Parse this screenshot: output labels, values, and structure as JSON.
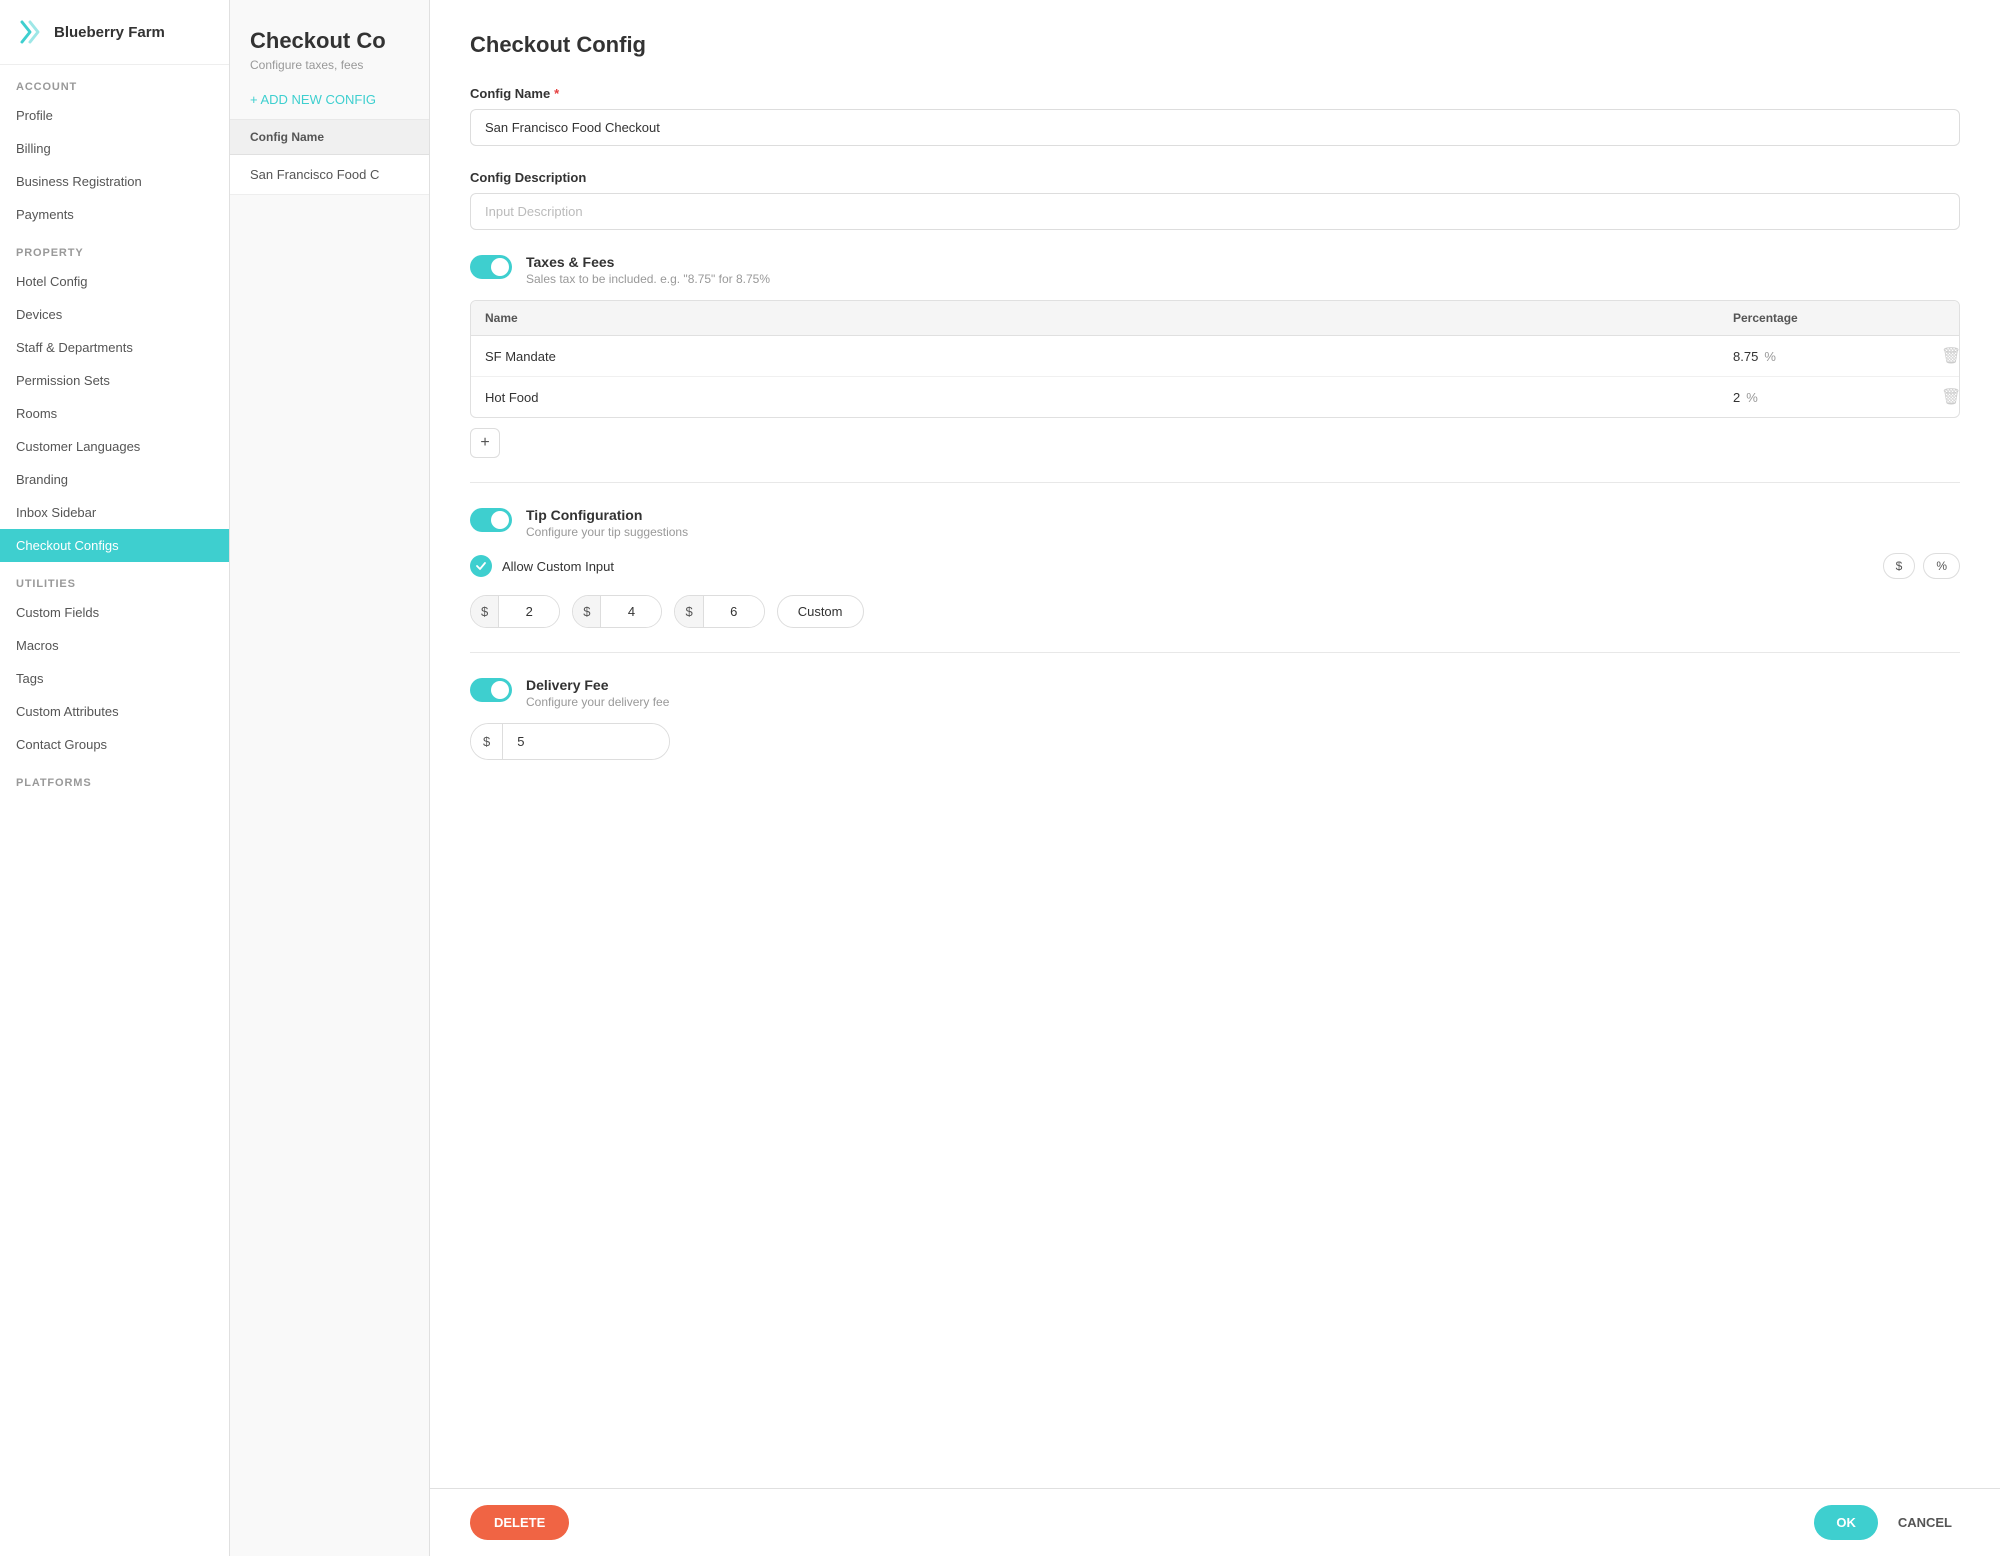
{
  "app": {
    "brand": "Blueberry Farm"
  },
  "sidebar": {
    "account_label": "ACCOUNT",
    "property_label": "PROPERTY",
    "utilities_label": "UTILITIES",
    "platforms_label": "PLATFORMS",
    "account_items": [
      {
        "id": "profile",
        "label": "Profile"
      },
      {
        "id": "billing",
        "label": "Billing"
      },
      {
        "id": "business-registration",
        "label": "Business Registration"
      },
      {
        "id": "payments",
        "label": "Payments"
      }
    ],
    "property_items": [
      {
        "id": "hotel-config",
        "label": "Hotel Config"
      },
      {
        "id": "devices",
        "label": "Devices"
      },
      {
        "id": "staff-departments",
        "label": "Staff & Departments"
      },
      {
        "id": "permission-sets",
        "label": "Permission Sets"
      },
      {
        "id": "rooms",
        "label": "Rooms"
      },
      {
        "id": "customer-languages",
        "label": "Customer Languages"
      },
      {
        "id": "branding",
        "label": "Branding"
      },
      {
        "id": "inbox-sidebar",
        "label": "Inbox Sidebar"
      },
      {
        "id": "checkout-configs",
        "label": "Checkout Configs",
        "active": true
      }
    ],
    "utilities_items": [
      {
        "id": "custom-fields",
        "label": "Custom Fields"
      },
      {
        "id": "macros",
        "label": "Macros"
      },
      {
        "id": "tags",
        "label": "Tags"
      },
      {
        "id": "custom-attributes",
        "label": "Custom Attributes"
      },
      {
        "id": "contact-groups",
        "label": "Contact Groups"
      }
    ]
  },
  "middle": {
    "title": "Checkout Co",
    "subtitle": "Configure taxes, fees",
    "add_btn": "+ ADD NEW CONFIG",
    "list_header": "Config Name",
    "list_items": [
      {
        "id": "sf-food",
        "label": "San Francisco Food C"
      }
    ]
  },
  "panel": {
    "title": "Checkout Config",
    "config_name_label": "Config Name",
    "config_name_value": "San Francisco Food Checkout",
    "config_desc_label": "Config Description",
    "config_desc_placeholder": "Input Description",
    "taxes_title": "Taxes & Fees",
    "taxes_subtitle": "Sales tax to be included. e.g. \"8.75\" for 8.75%",
    "taxes_col_name": "Name",
    "taxes_col_percentage": "Percentage",
    "taxes_rows": [
      {
        "name": "SF Mandate",
        "percentage": "8.75"
      },
      {
        "name": "Hot Food",
        "percentage": "2"
      }
    ],
    "tip_title": "Tip Configuration",
    "tip_subtitle": "Configure your tip suggestions",
    "allow_custom_label": "Allow Custom Input",
    "currency_dollar": "$",
    "currency_percent": "%",
    "tip_options": [
      {
        "currency": "$",
        "value": "2"
      },
      {
        "currency": "$",
        "value": "4"
      },
      {
        "currency": "$",
        "value": "6"
      }
    ],
    "tip_custom_label": "Custom",
    "delivery_title": "Delivery Fee",
    "delivery_subtitle": "Configure your delivery fee",
    "delivery_currency": "$",
    "delivery_value": "5",
    "delete_btn": "DELETE",
    "ok_btn": "OK",
    "cancel_btn": "CANCEL"
  }
}
